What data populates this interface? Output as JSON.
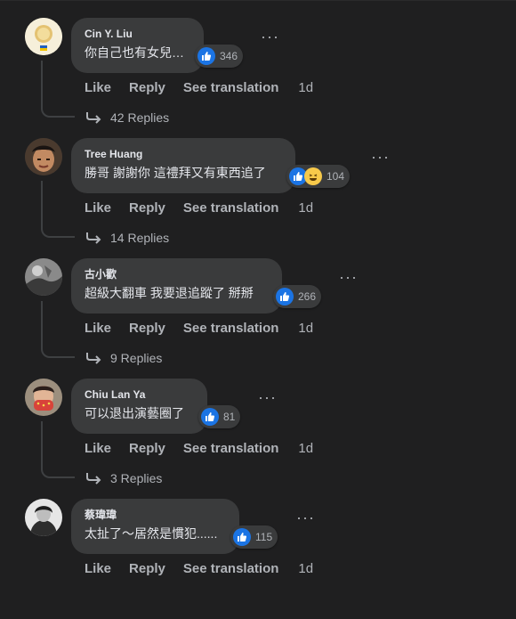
{
  "actions": {
    "like": "Like",
    "reply": "Reply",
    "translate": "See translation"
  },
  "comments": [
    {
      "author": "Cin Y. Liu",
      "text": "你自己也有女兒…",
      "reactions": [
        "like"
      ],
      "count": "346",
      "time": "1d",
      "replies": "42 Replies",
      "avatar_color": "#f3e7c6"
    },
    {
      "author": "Tree Huang",
      "text": "勝哥 謝謝你 這禮拜又有東西追了",
      "reactions": [
        "like",
        "haha"
      ],
      "count": "104",
      "time": "1d",
      "replies": "14 Replies",
      "avatar_color": "#6a5240"
    },
    {
      "author": "古小歡",
      "text": "超級大翻車 我要退追蹤了 掰掰",
      "reactions": [
        "like"
      ],
      "count": "266",
      "time": "1d",
      "replies": "9 Replies",
      "avatar_color": "#7a7a7a"
    },
    {
      "author": "Chiu Lan Ya",
      "text": "可以退出演藝圈了",
      "reactions": [
        "like"
      ],
      "count": "81",
      "time": "1d",
      "replies": "3 Replies",
      "avatar_color": "#b5544a"
    },
    {
      "author": "蔡瑋瑋",
      "text": "太扯了～居然是慣犯......",
      "reactions": [
        "like"
      ],
      "count": "115",
      "time": "1d",
      "replies": "",
      "avatar_color": "#d9d9d9"
    }
  ]
}
